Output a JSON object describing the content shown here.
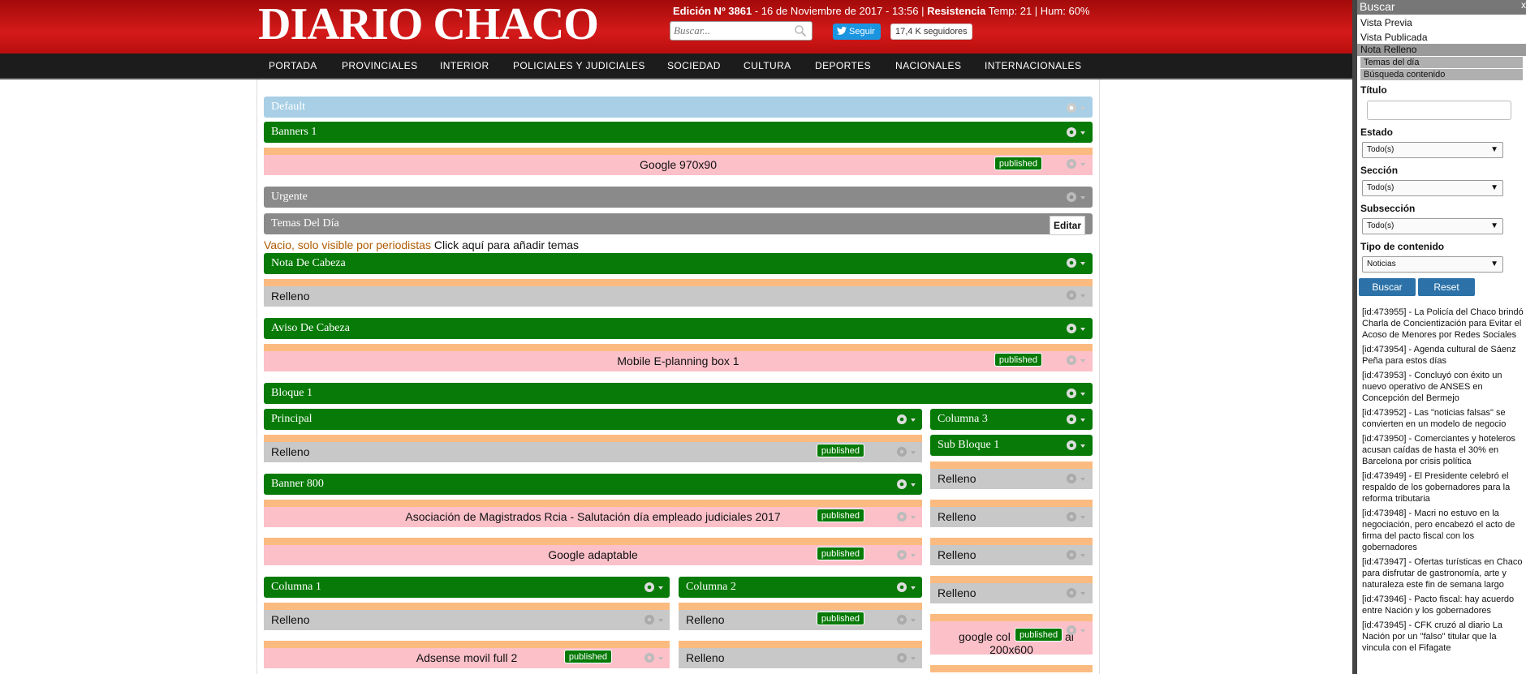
{
  "header": {
    "logo": "DIARIO CHACO",
    "edition_label": "Edición Nº 3861",
    "edition_date": " - 16 de Noviembre de 2017 - 13:56 | ",
    "weather_label": "Resistencia",
    "weather_text": " Temp: 21 | Hum: 60%",
    "search_placeholder": "Buscar...",
    "follow_label": "Seguir",
    "followers": "17,4 K seguidores"
  },
  "nav": [
    "PORTADA",
    "PROVINCIALES",
    "INTERIOR",
    "POLICIALES Y JUDICIALES",
    "SOCIEDAD",
    "CULTURA",
    "DEPORTES",
    "NACIONALES",
    "INTERNACIONALES"
  ],
  "blocks": {
    "default": "Default",
    "banners1": "Banners 1",
    "google970": "Google 970x90",
    "urgente": "Urgente",
    "temas": "Temas Del Día",
    "editar": "Editar",
    "vacio": "Vacio, solo visible por periodistas",
    "click_add": " Click aquí para añadir temas",
    "nota_cabeza": "Nota De Cabeza",
    "relleno": "Relleno",
    "aviso_cabeza": "Aviso De Cabeza",
    "mobile_eplanning": "Mobile E-planning box 1",
    "bloque1": "Bloque 1",
    "principal": "Principal",
    "columna3": "Columna 3",
    "sub_bloque1": "Sub Bloque 1",
    "banner800": "Banner 800",
    "asociacion": "Asociación de Magistrados Rcia - Salutación día empleado judiciales 2017",
    "google_adaptable": "Google adaptable",
    "columna1": "Columna 1",
    "columna2": "Columna 2",
    "adsense_movil": "Adsense movil full 2",
    "google_col": "google col",
    "google_col_b": "al",
    "google_col_size": "200x600",
    "published": "published"
  },
  "sidebar": {
    "head": "Buscar",
    "close": "x",
    "vista_previa": "Vista Previa",
    "vista_publicada": "Vista Publicada",
    "nota_relleno": "Nota Relleno",
    "temas_dia": "Temas del día",
    "busqueda": "Búsqueda contenido",
    "titulo_label": "Título",
    "estado_label": "Estado",
    "estado_value": "Todo(s)",
    "seccion_label": "Sección",
    "seccion_value": "Todo(s)",
    "subseccion_label": "Subsección",
    "subseccion_value": "Todo(s)",
    "tipo_label": "Tipo de contenido",
    "tipo_value": "Noticias",
    "buscar_btn": "Buscar",
    "reset_btn": "Reset",
    "results": [
      "[id:473955] - La Policía del Chaco brindó Charla de Concientización para Evitar el Acoso de Menores por Redes Sociales",
      "[id:473954] - Agenda cultural de Sáenz Peña para estos días",
      "[id:473953] - Concluyó con éxito un nuevo operativo de ANSES en Concepción del Bermejo",
      "[id:473952] - Las \"noticias falsas\" se convierten en un modelo de negocio",
      "[id:473950] - Comerciantes y hoteleros acusan caídas de hasta el 30% en Barcelona por crisis política",
      "[id:473949] - El Presidente celebró el respaldo de los gobernadores para la reforma tributaria",
      "[id:473948] - Macri no estuvo en la negociación, pero encabezó el acto de firma del pacto fiscal con los gobernadores",
      "[id:473947] - Ofertas turísticas en Chaco para disfrutar de gastronomía, arte y naturaleza este fin de semana largo",
      "[id:473946] - Pacto fiscal: hay acuerdo entre Nación y los gobernadores",
      "[id:473945] - CFK cruzó al diario La Nación por un \"falso\" titular que la vincula con el Fifagate"
    ]
  },
  "colors": {
    "header_red": "#c81212",
    "nav": "#1c1c1c",
    "green": "#077a07",
    "pink": "#fcc0c9",
    "orange": "#fbbb80",
    "blue": "#a8cfe6",
    "sidebar_btn": "#2c72a8"
  }
}
